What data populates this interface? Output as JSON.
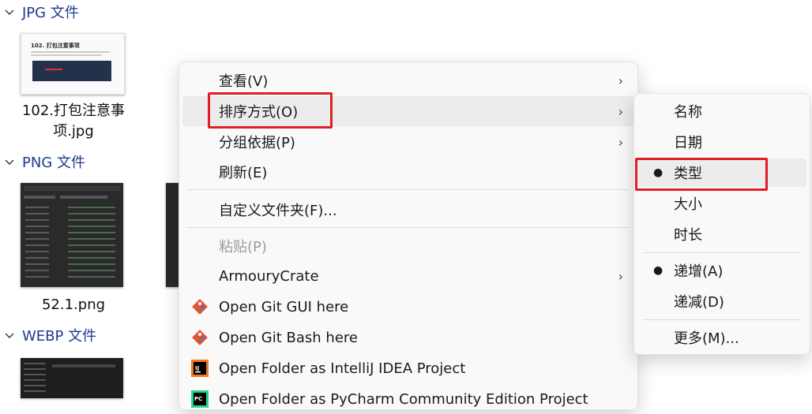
{
  "groups": [
    {
      "label": "JPG 文件"
    },
    {
      "label": "PNG 文件"
    },
    {
      "label": "WEBP 文件"
    }
  ],
  "files": {
    "jpg": {
      "name_line1": "102.打包注意事",
      "name_line2": "项.jpg",
      "thumb_title": "102. 打包注意事项"
    },
    "png": {
      "name": "52.1.png"
    }
  },
  "context_menu": {
    "items": [
      {
        "label": "查看(V)",
        "submenu": true
      },
      {
        "label": "排序方式(O)",
        "submenu": true
      },
      {
        "label": "分组依据(P)",
        "submenu": true
      },
      {
        "label": "刷新(E)"
      },
      {
        "label": "自定义文件夹(F)..."
      },
      {
        "label": "粘贴(P)",
        "disabled": true
      },
      {
        "label": "ArmouryCrate",
        "submenu": true
      },
      {
        "label": "Open Git GUI here",
        "icon": "git-icon"
      },
      {
        "label": "Open Git Bash here",
        "icon": "git-icon"
      },
      {
        "label": "Open Folder as IntelliJ IDEA Project",
        "icon": "intellij-icon"
      },
      {
        "label": "Open Folder as PyCharm Community Edition Project",
        "icon": "pycharm-icon"
      }
    ]
  },
  "sort_submenu": {
    "items": [
      {
        "label": "名称",
        "selected": false
      },
      {
        "label": "日期",
        "selected": false
      },
      {
        "label": "类型",
        "selected": true
      },
      {
        "label": "大小",
        "selected": false
      },
      {
        "label": "时长",
        "selected": false
      },
      {
        "label": "递增(A)",
        "selected": true
      },
      {
        "label": "递减(D)",
        "selected": false
      },
      {
        "label": "更多(M)...",
        "selected": false
      }
    ]
  },
  "colors": {
    "highlight_box": "#e11d27",
    "group_header": "#1f3a8a"
  }
}
